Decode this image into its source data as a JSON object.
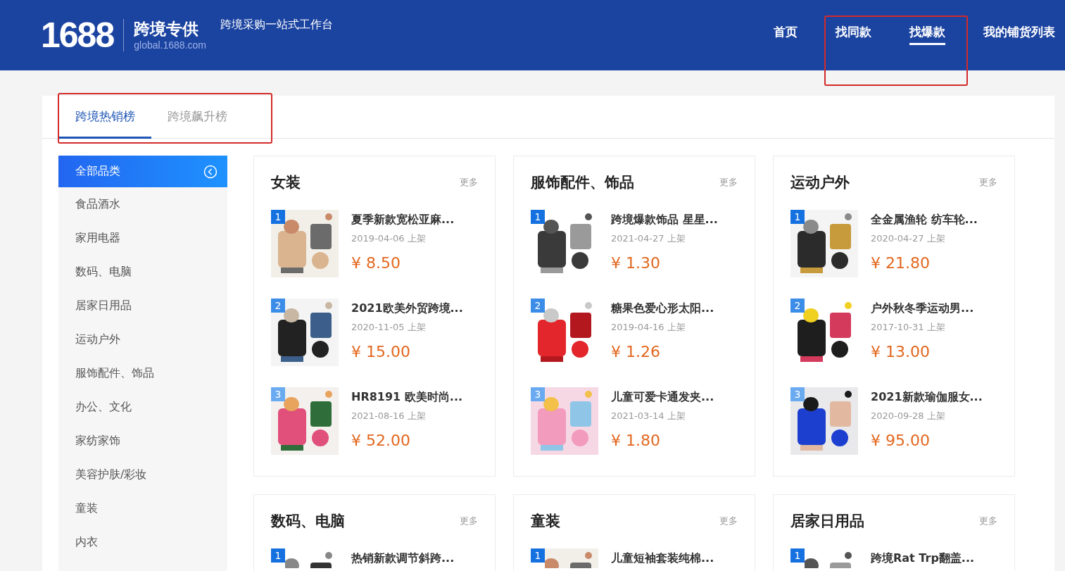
{
  "header": {
    "logo": "1688",
    "brand": "跨境专供",
    "domain": "global.1688.com",
    "subtitle": "跨境采购一站式工作台",
    "nav_highlighted": true,
    "nav": [
      {
        "label": "首页",
        "selected": false
      },
      {
        "label": "找同款",
        "selected": false
      },
      {
        "label": "找爆款",
        "selected": true
      },
      {
        "label": "我的铺货列表",
        "selected": false
      }
    ]
  },
  "tabs_highlighted": true,
  "tabs": [
    {
      "label": "跨境热销榜",
      "selected": true
    },
    {
      "label": "跨境飙升榜",
      "selected": false
    }
  ],
  "sidebar": {
    "items": [
      {
        "label": "全部品类",
        "selected": true
      },
      {
        "label": "食品酒水",
        "selected": false
      },
      {
        "label": "家用电器",
        "selected": false
      },
      {
        "label": "数码、电脑",
        "selected": false
      },
      {
        "label": "居家日用品",
        "selected": false
      },
      {
        "label": "运动户外",
        "selected": false
      },
      {
        "label": "服饰配件、饰品",
        "selected": false
      },
      {
        "label": "办公、文化",
        "selected": false
      },
      {
        "label": "家纺家饰",
        "selected": false
      },
      {
        "label": "美容护肤/彩妆",
        "selected": false
      },
      {
        "label": "童装",
        "selected": false
      },
      {
        "label": "内衣",
        "selected": false
      }
    ]
  },
  "cards": [
    {
      "title": "女装",
      "more": "更多",
      "items": [
        {
          "rank": "1",
          "title": "夏季新款宽松亚麻...",
          "date": "2019-04-06 上架",
          "price": "¥ 8.50"
        },
        {
          "rank": "2",
          "title": "2021欧美外贸跨境...",
          "date": "2020-11-05 上架",
          "price": "¥ 15.00"
        },
        {
          "rank": "3",
          "title": "HR8191 欧美时尚...",
          "date": "2021-08-16 上架",
          "price": "¥ 52.00"
        }
      ]
    },
    {
      "title": "服饰配件、饰品",
      "more": "更多",
      "items": [
        {
          "rank": "1",
          "title": "跨境爆款饰品 星星...",
          "date": "2021-04-27 上架",
          "price": "¥ 1.30"
        },
        {
          "rank": "2",
          "title": "糖果色爱心形太阳...",
          "date": "2019-04-16 上架",
          "price": "¥ 1.26"
        },
        {
          "rank": "3",
          "title": "儿童可爱卡通发夹...",
          "date": "2021-03-14 上架",
          "price": "¥ 1.80"
        }
      ]
    },
    {
      "title": "运动户外",
      "more": "更多",
      "items": [
        {
          "rank": "1",
          "title": "全金属渔轮 纺车轮...",
          "date": "2020-04-27 上架",
          "price": "¥ 21.80"
        },
        {
          "rank": "2",
          "title": "户外秋冬季运动男...",
          "date": "2017-10-31 上架",
          "price": "¥ 13.00"
        },
        {
          "rank": "3",
          "title": "2021新款瑜伽服女...",
          "date": "2020-09-28 上架",
          "price": "¥ 95.00"
        }
      ]
    },
    {
      "title": "数码、电脑",
      "more": "更多",
      "items": [
        {
          "rank": "1",
          "title": "热销新款调节斜跨..."
        }
      ]
    },
    {
      "title": "童装",
      "more": "更多",
      "items": [
        {
          "rank": "1",
          "title": "儿童短袖套装纯棉..."
        }
      ]
    },
    {
      "title": "居家日用品",
      "more": "更多",
      "items": [
        {
          "rank": "1",
          "title": "跨境Rat Trp翻盖..."
        }
      ]
    }
  ]
}
